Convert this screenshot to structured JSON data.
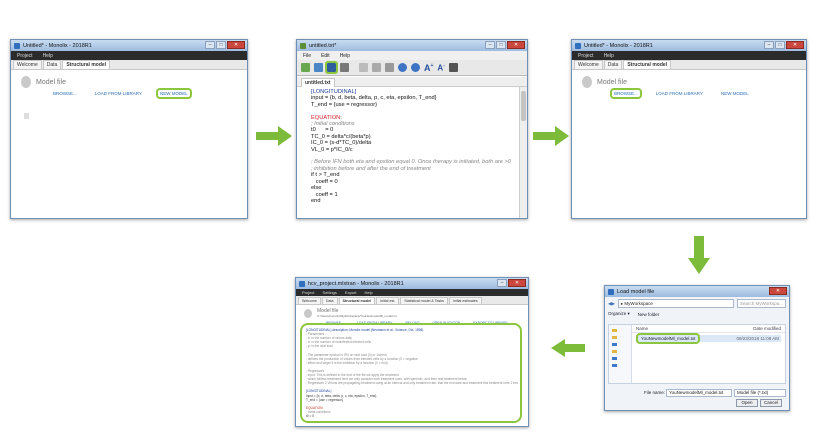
{
  "colors": {
    "highlight": "#8cc63f",
    "arrow": "#7dbb3a",
    "link": "#2a6fb8",
    "titlebar": "#9dbbe0"
  },
  "win1": {
    "title": "Untitled* - Monolix - 2018R1",
    "menu": [
      "Project",
      "Help"
    ],
    "tabs": [
      "Welcome",
      "Data",
      "Structural model"
    ],
    "model_label": "Model file",
    "actions": [
      "BROWSE...",
      "LOAD FROM LIBRARY",
      "NEW MODEL"
    ]
  },
  "win2": {
    "title": "untitled.txt*",
    "menu": [
      "File",
      "Edit",
      "Help"
    ],
    "tab": "untitled.txt",
    "code_lines": [
      "[LONGITUDINAL]",
      "input = {b, d, beta, delta, p, c, eta, epsilon, T_end}",
      "T_end = {use = regressor}",
      "",
      "EQUATION:",
      "; Initial conditions",
      "t0      = 0",
      "TC_0 = delta*c/(beta*p)",
      "IC_0 = (s-d*TC_0)/delta",
      "VL_0 = p*IC_0/c",
      "",
      "; Before IFN both eta and epsilon equal 0. Once therapy is initiated, both are >0",
      "; inhibition before and after the end of treatment",
      "if t > T_end",
      "   coeff = 0",
      "else",
      "   coeff = 1",
      "end"
    ]
  },
  "win3": {
    "title": "Untitled* - Monolix - 2018R1",
    "menu": [
      "Project",
      "Help"
    ],
    "tabs": [
      "Welcome",
      "Data",
      "Structural model"
    ],
    "model_label": "Model file",
    "actions": [
      "BROWSE...",
      "LOAD FROM LIBRARY",
      "NEW MODEL"
    ]
  },
  "win4": {
    "title": "Load model file",
    "path": "▸ MyWorkspace",
    "search": "Search MyWorkspa...",
    "toolbar": [
      "Organize ▾",
      "New folder"
    ],
    "columns": [
      "Name",
      "Date modified"
    ],
    "file": "YouNewmodelMl_model.txt",
    "file_date": "09/23/2018 11:08 AM",
    "filename_label": "File name:",
    "filename_value": "YouNewmodelMl_model.txt",
    "filetype": "Model file (*.txt)",
    "open": "Open",
    "cancel": "Cancel"
  },
  "win5": {
    "title": "hcv_project.mlxtran - Monolix - 2018R1",
    "menu": [
      "Project",
      "Settings",
      "Export",
      "Help"
    ],
    "tabs": [
      "Welcome",
      "Data",
      "Structural model",
      "Initial est.",
      "Statistical model & Tasks",
      "Initial estimates"
    ],
    "model_label": "Model file",
    "path": "C:/Users/monolix/MyWorkspace/YouNewmodelMl_model.txt",
    "actions": [
      "BROWSE...",
      "LOAD FROM LIBRARY",
      "RELOAD",
      "OPEN IN EDITOR",
      "EXPORT TO LIBRARY"
    ],
    "code_lines": [
      "[LONGITUDINAL] description: Monolix model (Neumann et al., Science, Oct. 1998)",
      "; Parameters",
      "; b: in the number of virions daily",
      "; d: in the number of noninfected infected cells",
      "; p: in the viral load",
      "",
      "; The parameter epsilon is IFN on viral load (0) or 1st/mid",
      "; defines the production of virions from infected cells by a function (0 = negative",
      "; effect and larger it is the inhibition by a function (0 = mid)",
      "",
      "; Regressors",
      "; input: This is defined in the end of the file we apply the treatment",
      "; which follows treatment here we only consider both treatment ones, with symbolic, and then real treatment below",
      "; Regression 2 Virions are propagating treatment using at an interval and only treatment rate, that the end date and treatment this treatment here 2 treatment 2",
      "",
      "[LONGITUDINAL]",
      "input = {b, d, beta, delta, p, c, eta, epsilon, T_end}",
      "T_end = {use = regressor}",
      "",
      "EQUATION:",
      "; Initial conditions",
      "t0 = 0",
      "TC_0 = delta*c/(beta*p)",
      "IC_0 = (s-d*TC_0)/delta",
      "VL_0 = p*IC_0/c",
      "",
      "; Before IFN both eta and epsilon equal 0. Once therapy is initiated, both are >0",
      "; inhibition before and after the end of treatment"
    ]
  }
}
